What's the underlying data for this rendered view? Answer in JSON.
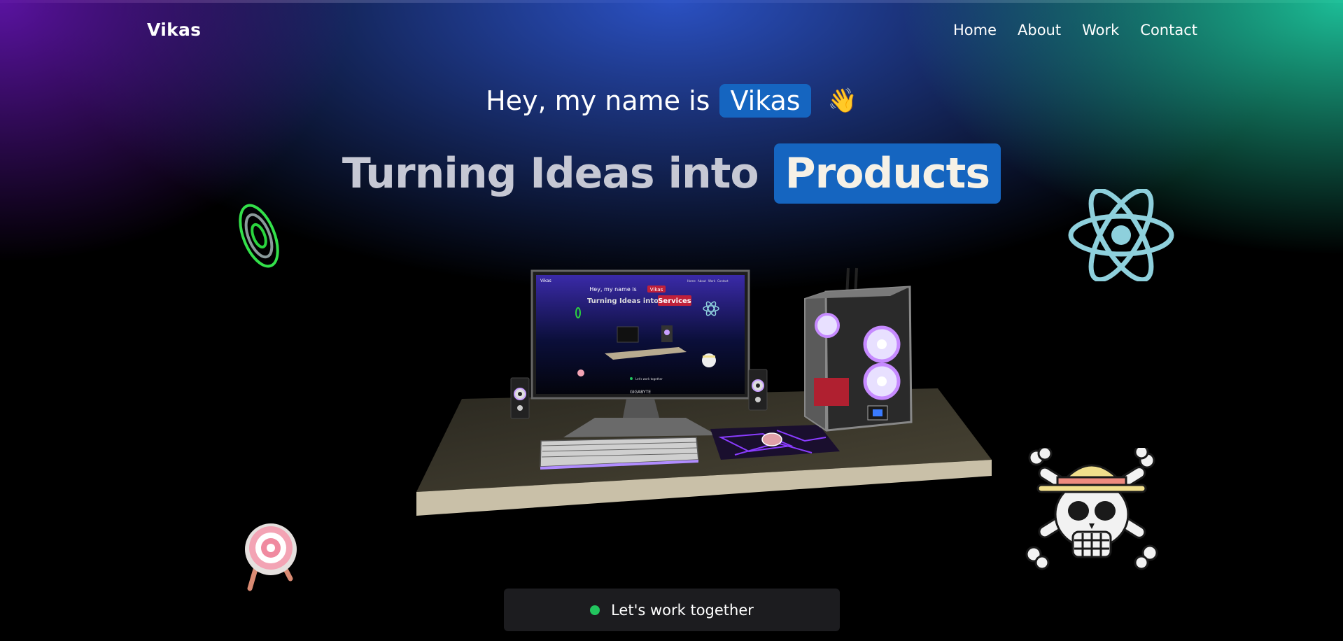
{
  "nav": {
    "logo": "Vikas",
    "links": [
      {
        "label": "Home"
      },
      {
        "label": "About"
      },
      {
        "label": "Work"
      },
      {
        "label": "Contact"
      }
    ]
  },
  "hero": {
    "intro": "Hey, my name is",
    "name": "Vikas",
    "wave_emoji": "👋",
    "headline": "Turning Ideas into",
    "highlight_word": "Products"
  },
  "screen": {
    "brand": "GIGABYTE",
    "mini_intro": "Hey, my name is",
    "mini_name": "Vikas",
    "mini_headline": "Turning Ideas into",
    "mini_highlight": "Services",
    "mini_nav": [
      "Home",
      "About",
      "Work",
      "Contact"
    ],
    "mini_cta": "Let's work together"
  },
  "decorations": [
    "ring-icon",
    "react-atom-icon",
    "target-icon",
    "straw-hat-jolly-roger-icon"
  ],
  "cta": {
    "label": "Let's work together",
    "status_color": "#22c55e"
  },
  "colors": {
    "accent": "#1565c0",
    "teal_glow": "#1ec8a0",
    "purple_glow": "#5f14aa",
    "blue_glow": "#2d55cd"
  }
}
